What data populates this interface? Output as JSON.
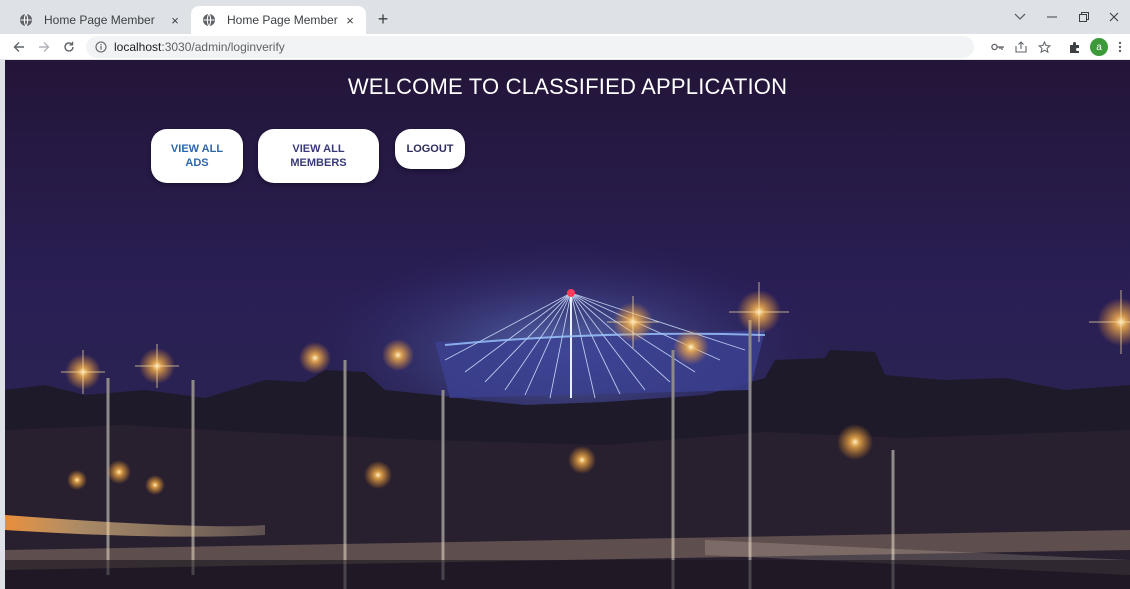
{
  "browser": {
    "tabs": [
      {
        "title": "Home Page Member",
        "active": false
      },
      {
        "title": "Home Page Member",
        "active": true
      }
    ],
    "new_tab_glyph": "+",
    "close_glyph": "×",
    "address": {
      "host": "localhost",
      "path": ":3030/admin/loginverify"
    },
    "profile_initial": "a",
    "icons": [
      "globe-icon",
      "back-icon",
      "forward-icon",
      "reload-icon",
      "info-icon",
      "key-icon",
      "share-icon",
      "star-icon",
      "extensions-icon",
      "menu-icon"
    ]
  },
  "page": {
    "heading": "WELCOME TO CLASSIFIED APPLICATION",
    "buttons": {
      "view_ads_line1": "VIEW ALL",
      "view_ads_line2": "ADS",
      "view_members_line1": "VIEW ALL",
      "view_members_line2": "MEMBERS",
      "logout": "LOGOUT"
    }
  },
  "colors": {
    "sky": "#25193f",
    "lights": "#ffd27a",
    "bridge": "#cfe3ff",
    "button_bg": "#ffffff",
    "button_text": "#2d67a8"
  }
}
